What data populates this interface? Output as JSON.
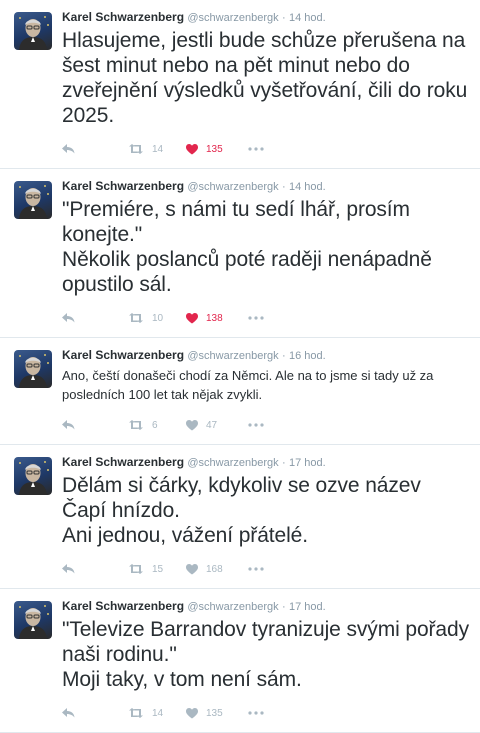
{
  "tweets": [
    {
      "name": "Karel Schwarzenberg",
      "handle": "@schwarzenbergk",
      "time": "14 hod.",
      "size": "large",
      "lines": [
        "Hlasujeme, jestli bude schůze přerušena na šest minut nebo na pět minut nebo do zveřejnění výsledků vyšetřování, čili do roku 2025."
      ],
      "retweets": "14",
      "likes": "135",
      "liked": true
    },
    {
      "name": "Karel Schwarzenberg",
      "handle": "@schwarzenbergk",
      "time": "14 hod.",
      "size": "large",
      "lines": [
        "\"Premiére, s námi tu sedí lhář, prosím konejte.\"",
        "Několik poslanců poté raději nenápadně opustilo sál."
      ],
      "retweets": "10",
      "likes": "138",
      "liked": true
    },
    {
      "name": "Karel Schwarzenberg",
      "handle": "@schwarzenbergk",
      "time": "16 hod.",
      "size": "small",
      "lines": [
        "Ano, čeští donašeči chodí za Němci. Ale na to jsme si tady už za posledních 100 let tak nějak zvykli."
      ],
      "retweets": "6",
      "likes": "47",
      "liked": false
    },
    {
      "name": "Karel Schwarzenberg",
      "handle": "@schwarzenbergk",
      "time": "17 hod.",
      "size": "large",
      "lines": [
        "Dělám si čárky, kdykoliv se ozve název Čapí hnízdo.",
        "Ani jednou, vážení přátelé."
      ],
      "retweets": "15",
      "likes": "168",
      "liked": false
    },
    {
      "name": "Karel Schwarzenberg",
      "handle": "@schwarzenbergk",
      "time": "17 hod.",
      "size": "large",
      "lines": [
        "\"Televize Barrandov tyranizuje svými pořady naši rodinu.\"",
        "Moji taky, v tom není sám."
      ],
      "retweets": "14",
      "likes": "135",
      "liked": false
    }
  ],
  "header_separator": "·",
  "icons": {
    "reply": "reply-icon",
    "retweet": "retweet-icon",
    "like": "heart-icon",
    "more": "more-icon"
  },
  "colors": {
    "like_active": "#e2264d",
    "muted": "#aab8c2",
    "meta": "#8899a6",
    "divider": "#e1e8ed"
  }
}
